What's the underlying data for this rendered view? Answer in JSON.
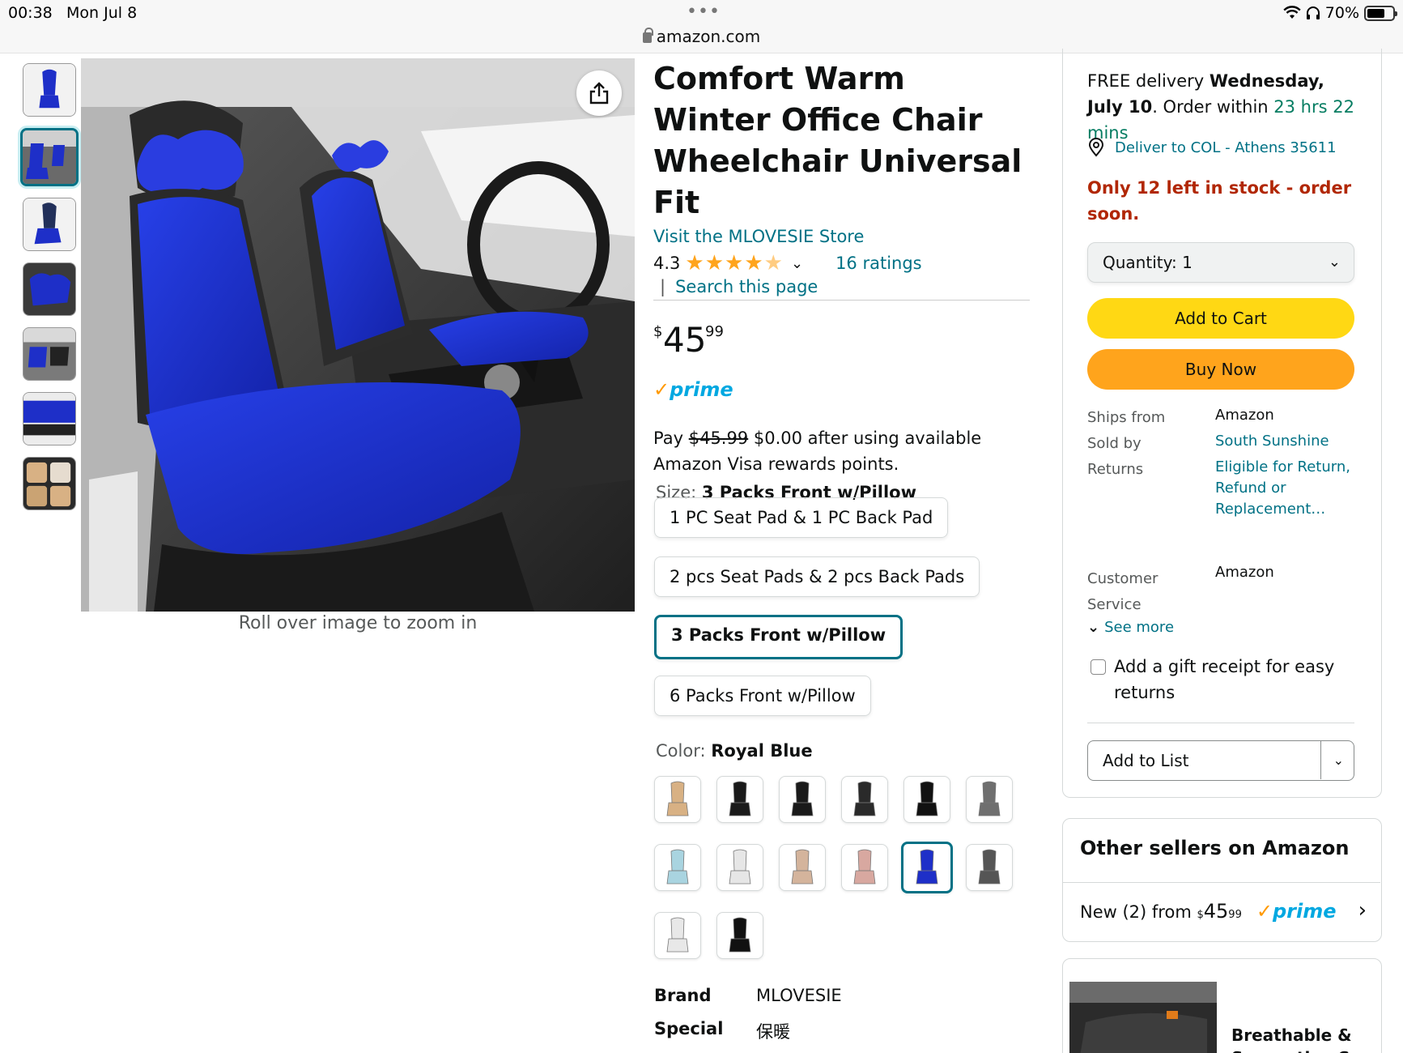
{
  "status_bar": {
    "time": "00:38",
    "date": "Mon Jul 8",
    "dots": "•••",
    "url": "amazon.com",
    "battery": "70%"
  },
  "gallery": {
    "caption": "Roll over image to zoom in",
    "thumbnails": [
      "blue seat",
      "blue seats in car",
      "blue seat side",
      "blue cushion",
      "blue seat interior",
      "blue seat cover flat",
      "beige seat covers"
    ]
  },
  "product": {
    "title": "Comfort Warm Winter Office Chair Wheelchair Universal Fit",
    "store": "Visit the MLOVESIE Store",
    "rating": "4.3",
    "ratings_count": "16 ratings",
    "search_sep": "|",
    "search_link": "Search this page",
    "price": {
      "symbol": "$",
      "whole": "45",
      "fraction": "99"
    },
    "prime": "prime",
    "pay_prefix": "Pay",
    "pay_strike": "$45.99",
    "pay_rest": "$0.00 after using available Amazon Visa rewards points.",
    "size_label": "Size:",
    "size_selected": "3 Packs Front w/Pillow",
    "sizes": [
      "1 PC Seat Pad & 1 PC Back Pad",
      "2 pcs Seat Pads & 2 pcs Back Pads",
      "3 Packs Front w/Pillow",
      "6 Packs Front w/Pillow"
    ],
    "color_label": "Color:",
    "color_selected": "Royal Blue",
    "swatch_colors": [
      "#d8b184",
      "#1a1a1a",
      "#1a1a1a",
      "#2a2a2a",
      "#111111",
      "#6f6f6f",
      "#a9d4e0",
      "#e6e6e6",
      "#d4b49c",
      "#d8a8a0",
      "#1e2fc8",
      "#555555",
      "#e8e8e8",
      "#111111"
    ],
    "specs": [
      {
        "key": "Brand",
        "value": "MLOVESIE"
      },
      {
        "key": "Special",
        "value": "保暖"
      }
    ]
  },
  "buybox": {
    "delivery_prefix": "FREE delivery",
    "delivery_date": "Wednesday, July 10",
    "order_within": ". Order within",
    "countdown": "23 hrs 22 mins",
    "deliver_to": "Deliver to COL - Athens 35611",
    "stock": "Only 12 left in stock - order soon.",
    "quantity": "Quantity:  1",
    "add_to_cart": "Add to Cart",
    "buy_now": "Buy Now",
    "ships_from_label": "Ships from",
    "ships_from": "Amazon",
    "sold_by_label": "Sold by",
    "sold_by": "South Sunshine",
    "returns_label": "Returns",
    "returns": "Eligible for Return, Refund or Replacement…",
    "customer_service_label": "Customer Service",
    "customer_service": "Amazon",
    "see_more": "See more",
    "gift_receipt": "Add a gift receipt for easy returns",
    "add_to_list": "Add to List"
  },
  "other_sellers": {
    "heading": "Other sellers on Amazon",
    "offer_prefix": "New (2) from",
    "price_symbol": "$",
    "price_whole": "45",
    "price_fraction": "99",
    "prime": "prime"
  },
  "recommendation": {
    "text": "Breathable & Supportive C"
  },
  "colors": {
    "link": "#007185",
    "cart": "#ffd814",
    "buy": "#ffa41c",
    "stock": "#b12704",
    "green": "#067d62",
    "prime": "#00a8e1"
  }
}
